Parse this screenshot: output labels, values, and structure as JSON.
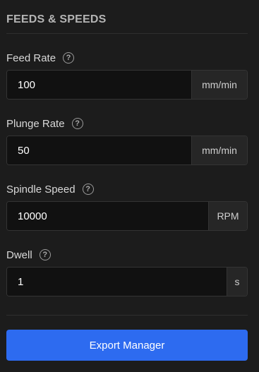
{
  "section": {
    "title": "FEEDS & SPEEDS"
  },
  "fields": [
    {
      "label": "Feed Rate",
      "help_glyph": "?",
      "value": "100",
      "unit": "mm/min"
    },
    {
      "label": "Plunge Rate",
      "help_glyph": "?",
      "value": "50",
      "unit": "mm/min"
    },
    {
      "label": "Spindle Speed",
      "help_glyph": "?",
      "value": "10000",
      "unit": "RPM"
    },
    {
      "label": "Dwell",
      "help_glyph": "?",
      "value": "1",
      "unit": "s"
    }
  ],
  "actions": {
    "export_label": "Export Manager"
  },
  "colors": {
    "background": "#1c1c1c",
    "input_background": "#111111",
    "unit_background": "#262626",
    "accent": "#2d6bf0"
  },
  "icons": {
    "help": "help-circle-icon"
  }
}
